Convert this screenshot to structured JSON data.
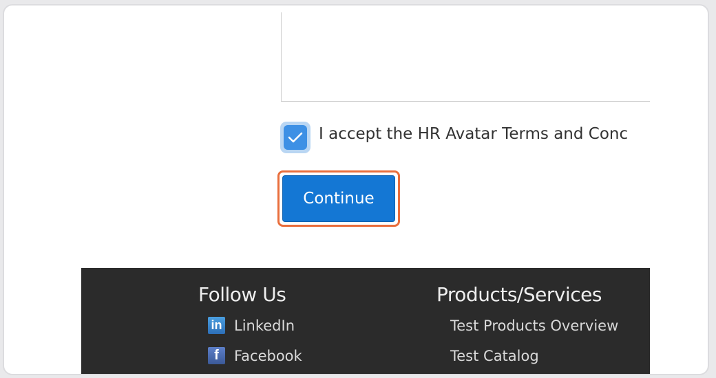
{
  "form": {
    "terms_label": "I accept the HR Avatar Terms and Conc",
    "terms_checked": true,
    "continue_label": "Continue"
  },
  "footer": {
    "follow_heading": "Follow Us",
    "social_links": [
      {
        "label": "LinkedIn",
        "icon": "linkedin-icon",
        "glyph": "in"
      },
      {
        "label": "Facebook",
        "icon": "facebook-icon",
        "glyph": "f"
      }
    ],
    "products_heading": "Products/Services",
    "product_links": [
      {
        "label": "Test Products Overview"
      },
      {
        "label": "Test Catalog"
      }
    ]
  },
  "colors": {
    "button": "#1477d4",
    "highlight": "#e96e3c",
    "checkbox": "#3d90e5",
    "footer_bg": "#2b2b2b"
  }
}
